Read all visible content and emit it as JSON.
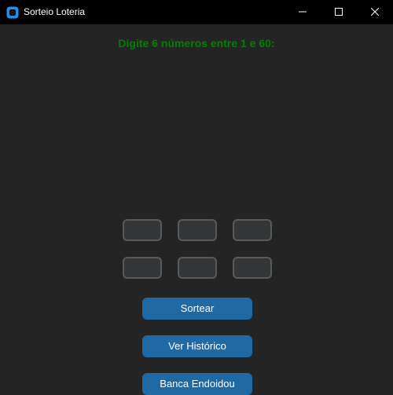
{
  "window": {
    "title": "Sorteio Loteria",
    "app_icon": "app-icon",
    "controls": [
      "minimize-icon",
      "maximize-icon",
      "close-icon"
    ]
  },
  "main": {
    "prompt": "Digite 6 números entre 1 e 60:",
    "number_inputs": [
      "",
      "",
      "",
      "",
      "",
      ""
    ],
    "buttons": {
      "draw_label": "Sortear",
      "history_label": "Ver Histórico",
      "bank_label": "Banca Endoidou"
    }
  },
  "colors": {
    "background": "#242424",
    "titlebar": "#000000",
    "prompt_text": "#008000",
    "input_fill": "#343638",
    "input_border": "#565b5e",
    "button": "#1f6aa5",
    "button_text": "#ffffff",
    "app_icon": "#1f8fe8"
  }
}
